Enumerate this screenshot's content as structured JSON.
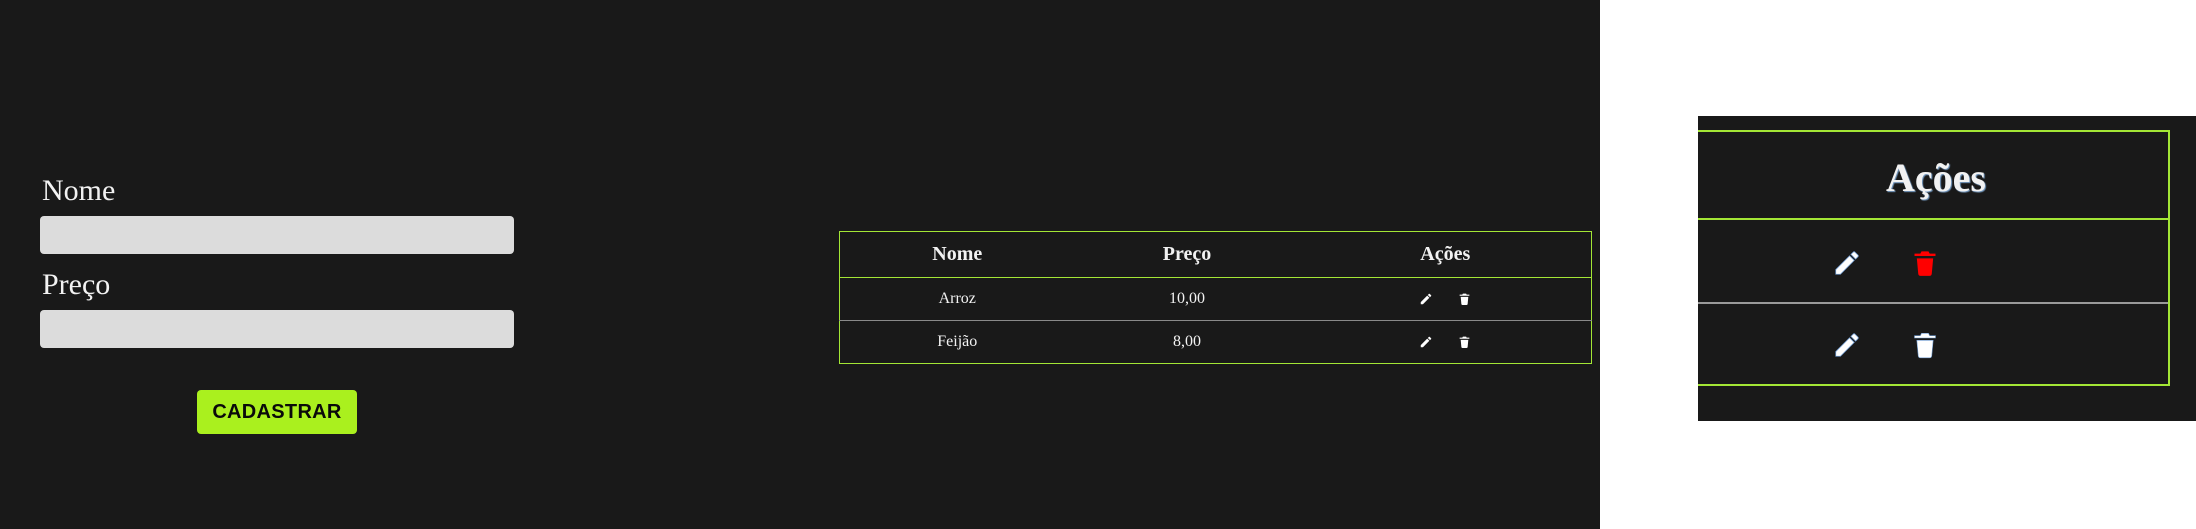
{
  "form": {
    "nome_label": "Nome",
    "preco_label": "Preço",
    "nome_value": "",
    "preco_value": "",
    "submit_label": "CADASTRAR"
  },
  "table": {
    "headers": [
      "Nome",
      "Preço",
      "Ações"
    ],
    "rows": [
      {
        "nome": "Arroz",
        "preco": "10,00",
        "actions": [
          "edit-icon",
          "trash-icon"
        ]
      },
      {
        "nome": "Feijão",
        "preco": "8,00",
        "actions": [
          "edit-icon",
          "trash-icon"
        ]
      }
    ]
  },
  "zoom": {
    "title": "Ações",
    "rows": [
      {
        "actions": [
          "edit-icon",
          "trash-icon"
        ],
        "trash_color": "#ff0000"
      },
      {
        "actions": [
          "edit-icon",
          "trash-icon"
        ],
        "trash_color": "#ffffff"
      }
    ]
  },
  "colors": {
    "background": "#191919",
    "accent": "#aaf01e",
    "border": "#a3e635",
    "text": "#f2f2f2",
    "input": "#dcdcdc",
    "trash_hover": "#ff0000"
  }
}
